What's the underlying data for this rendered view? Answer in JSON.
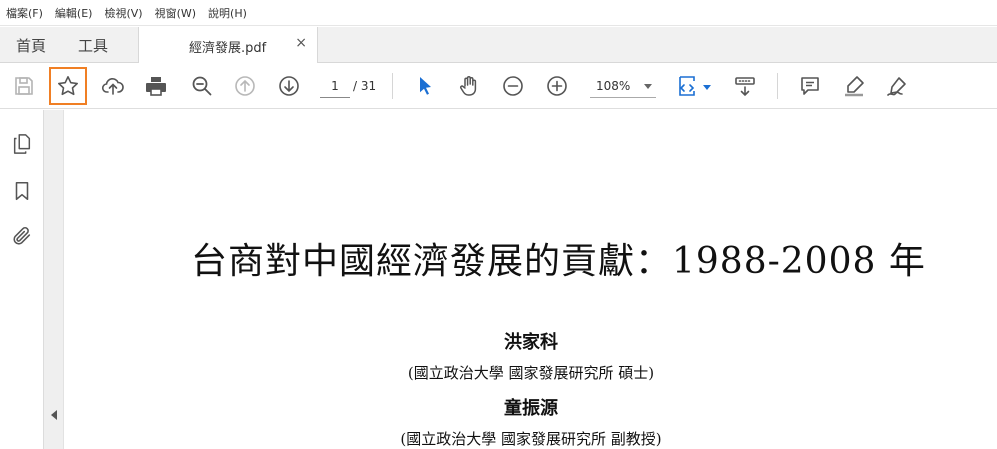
{
  "menu": [
    "檔案(F)",
    "編輯(E)",
    "檢視(V)",
    "視窗(W)",
    "說明(H)"
  ],
  "tabs": {
    "home": "首頁",
    "tools": "工具"
  },
  "document_tab": {
    "title": "經濟發展.pdf",
    "close": "×"
  },
  "toolbar": {
    "page_current": "1",
    "page_total": "/ 31",
    "zoom": "108%",
    "highlighted_button": "bookmark-star",
    "accent_color": "#f07f24",
    "active_tool_color": "#1b6fd3",
    "icons": [
      "save-icon",
      "star-icon",
      "upload-icon",
      "print-icon",
      "zoom-search-icon",
      "page-up-icon",
      "page-down-icon",
      "select-arrow-icon",
      "hand-icon",
      "zoom-out-icon",
      "zoom-in-icon",
      "fit-page-icon",
      "scroll-mode-icon",
      "comment-icon",
      "highlight-pen-icon",
      "sign-icon"
    ]
  },
  "left_nav": {
    "icons": [
      "pages-icon",
      "bookmark-icon",
      "attachment-icon"
    ]
  },
  "document": {
    "title": "台商對中國經濟發展的貢獻：1988-2008 年",
    "author1": "洪家科",
    "affiliation1": "(國立政治大學 國家發展研究所 碩士)",
    "author2": "童振源",
    "affiliation2": "(國立政治大學 國家發展研究所 副教授)"
  }
}
